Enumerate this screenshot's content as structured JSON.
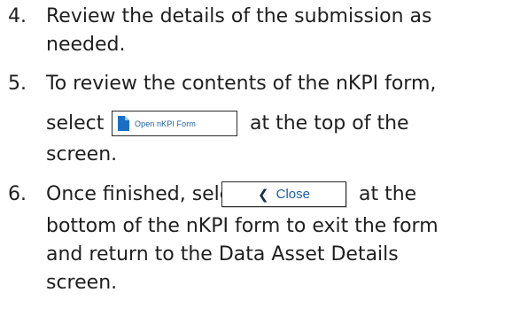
{
  "steps": [
    {
      "number": "4.",
      "lines": [
        "Review the details of the submission as",
        "needed."
      ]
    },
    {
      "number": "5.",
      "lines": [
        "To review the contents of the nKPI form,",
        "select",
        "at the top of the",
        "screen."
      ],
      "button": {
        "label": "Open nKPI Form",
        "icon": "document-icon"
      }
    },
    {
      "number": "6.",
      "lines": [
        "Once finished, select",
        "at the",
        "bottom of the nKPI form to exit the form",
        "and return to the Data Asset Details",
        "screen."
      ],
      "button": {
        "label": "Close",
        "icon": "chevron-left-icon"
      }
    }
  ]
}
